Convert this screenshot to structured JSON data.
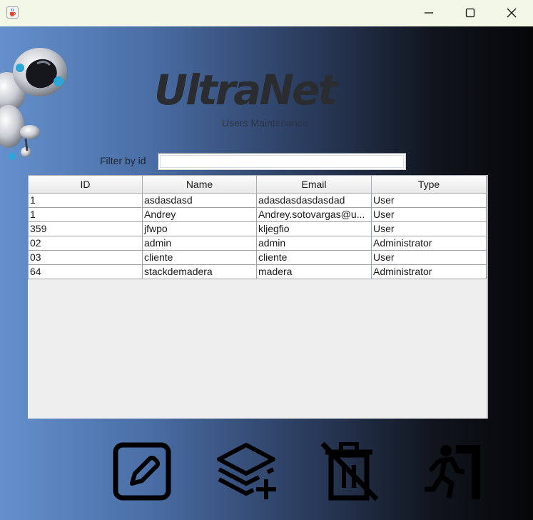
{
  "window": {
    "app_icon": "java-cup-icon",
    "controls": [
      "minimize-icon",
      "maximize-icon",
      "close-icon"
    ]
  },
  "header": {
    "logo": "UltraNet",
    "subtitle": "Users Maintenance"
  },
  "filter": {
    "label": "Filter by id",
    "value": "",
    "placeholder": ""
  },
  "table": {
    "columns": [
      "ID",
      "Name",
      "Email",
      "Type"
    ],
    "rows": [
      [
        "1",
        "asdasdasd",
        "adasdasdasdasdad",
        "User"
      ],
      [
        "1",
        "Andrey",
        "Andrey.sotovargas@u...",
        "User"
      ],
      [
        "359",
        "jfwpo",
        "kljegfio",
        "User"
      ],
      [
        "02",
        "admin",
        "admin",
        "Administrator"
      ],
      [
        "03",
        "cliente",
        "cliente",
        "User"
      ],
      [
        "64",
        "stackdemadera",
        "madera",
        "Administrator"
      ]
    ]
  },
  "actions": [
    {
      "name": "edit-user-button",
      "icon": "pencil-square-icon"
    },
    {
      "name": "add-user-button",
      "icon": "layers-add-icon"
    },
    {
      "name": "delete-user-button",
      "icon": "trash-disabled-icon"
    },
    {
      "name": "exit-button",
      "icon": "exit-door-icon"
    }
  ],
  "colors": {
    "titlebar": "#f2f7e6",
    "gradient_left": "#6590cc",
    "gradient_right": "#050608",
    "logo": "#2a2c30"
  }
}
